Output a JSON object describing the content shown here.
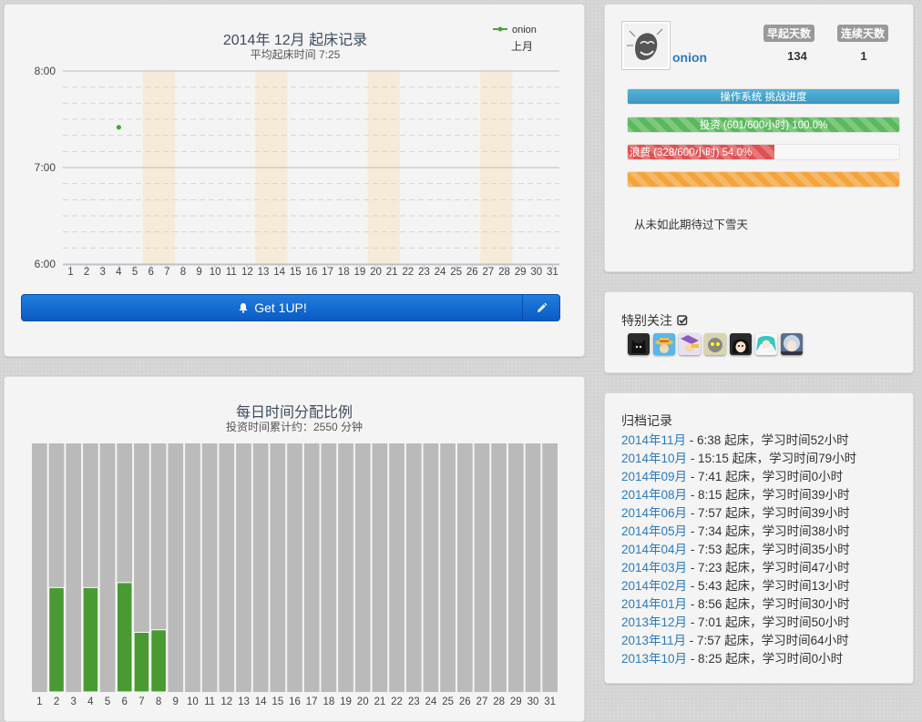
{
  "wake_chart": {
    "title": "2014年 12月 起床记录",
    "subtitle": "平均起床时间 7:25",
    "legend_series": "onion",
    "legend_prev": "上月",
    "y_ticks": [
      "8:00",
      "7:00",
      "6:00"
    ],
    "x_ticks": [
      "1",
      "2",
      "3",
      "4",
      "5",
      "6",
      "7",
      "8",
      "9",
      "10",
      "11",
      "12",
      "13",
      "14",
      "15",
      "16",
      "17",
      "18",
      "19",
      "20",
      "21",
      "22",
      "23",
      "24",
      "25",
      "26",
      "27",
      "28",
      "29",
      "30",
      "31"
    ],
    "highlight_days": [
      [
        6,
        7
      ],
      [
        13,
        14
      ],
      [
        20,
        21
      ],
      [
        27,
        28
      ]
    ],
    "colors": {
      "point": "#4ea03a",
      "weekend": "#f6ebd8"
    }
  },
  "time_chart": {
    "title": "每日时间分配比例",
    "subtitle": "投资时间累计约：2550 分钟",
    "x_ticks": [
      "1",
      "2",
      "3",
      "4",
      "5",
      "6",
      "7",
      "8",
      "9",
      "10",
      "11",
      "12",
      "13",
      "14",
      "15",
      "16",
      "17",
      "18",
      "19",
      "20",
      "21",
      "22",
      "23",
      "24",
      "25",
      "26",
      "27",
      "28",
      "29",
      "30",
      "31"
    ],
    "colors": {
      "bar": "#4a9a34",
      "bg": "#bababa"
    }
  },
  "chart_data": [
    {
      "type": "scatter",
      "title": "2014年 12月 起床记录",
      "subtitle": "平均起床时间 7:25",
      "xlabel": "",
      "ylabel": "",
      "x_range": [
        1,
        31
      ],
      "y_range": [
        "6:00",
        "8:00"
      ],
      "y_reversed": true,
      "grid": true,
      "legend": "top-right",
      "series": [
        {
          "name": "onion",
          "points": [
            {
              "x": 4,
              "y": "7:25"
            }
          ]
        }
      ]
    },
    {
      "type": "bar",
      "title": "每日时间分配比例",
      "subtitle": "投资时间累计约：2550 分钟",
      "categories": [
        "1",
        "2",
        "3",
        "4",
        "5",
        "6",
        "7",
        "8",
        "9",
        "10",
        "11",
        "12",
        "13",
        "14",
        "15",
        "16",
        "17",
        "18",
        "19",
        "20",
        "21",
        "22",
        "23",
        "24",
        "25",
        "26",
        "27",
        "28",
        "29",
        "30",
        "31"
      ],
      "values": [
        0,
        0.42,
        0,
        0.42,
        0,
        0.44,
        0.24,
        0.25,
        0,
        0,
        0,
        0,
        0,
        0,
        0,
        0,
        0,
        0,
        0,
        0,
        0,
        0,
        0,
        0,
        0,
        0,
        0,
        0,
        0,
        0,
        0
      ],
      "ylim": [
        0,
        1
      ],
      "grid": false
    }
  ],
  "get1up": {
    "label": "Get 1UP!",
    "icon": "bell-icon",
    "edit_icon": "pencil-icon"
  },
  "profile": {
    "username": "onion",
    "early_label": "早起天数",
    "streak_label": "连续天数",
    "early_value": "134",
    "streak_value": "1",
    "bars": [
      {
        "label": "操作系统 挑战进度",
        "value": 1.0,
        "color": "#3fa2c8"
      },
      {
        "label": "投资 (601/600小时) 100.0%",
        "value": 1.0,
        "color": "#5cb85c"
      },
      {
        "label": "浪费 (328/600小时) 54.0%",
        "value": 0.54,
        "color": "#e05252"
      },
      {
        "label": "",
        "value": 1.0,
        "color": "#f4a43a"
      }
    ],
    "motto": "从未如此期待过下雪天"
  },
  "follow": {
    "title": "特别关注",
    "check_icon": "check-square-icon"
  },
  "archive": {
    "title": "归档记录",
    "rows": [
      {
        "month": "2014年11月",
        "text": " - 6:38 起床，学习时间52小时"
      },
      {
        "month": "2014年10月",
        "text": " - 15:15 起床，学习时间79小时"
      },
      {
        "month": "2014年09月",
        "text": " - 7:41 起床，学习时间0小时"
      },
      {
        "month": "2014年08月",
        "text": " - 8:15 起床，学习时间39小时"
      },
      {
        "month": "2014年06月",
        "text": " - 7:57 起床，学习时间39小时"
      },
      {
        "month": "2014年05月",
        "text": " - 7:34 起床，学习时间38小时"
      },
      {
        "month": "2014年04月",
        "text": " - 7:53 起床，学习时间35小时"
      },
      {
        "month": "2014年03月",
        "text": " - 7:23 起床，学习时间47小时"
      },
      {
        "month": "2014年02月",
        "text": " - 5:43 起床，学习时间13小时"
      },
      {
        "month": "2014年01月",
        "text": " - 8:56 起床，学习时间30小时"
      },
      {
        "month": "2013年12月",
        "text": " - 7:01 起床，学习时间50小时"
      },
      {
        "month": "2013年11月",
        "text": " - 7:57 起床，学习时间64小时"
      },
      {
        "month": "2013年10月",
        "text": " - 8:25 起床，学习时间0小时"
      }
    ]
  }
}
